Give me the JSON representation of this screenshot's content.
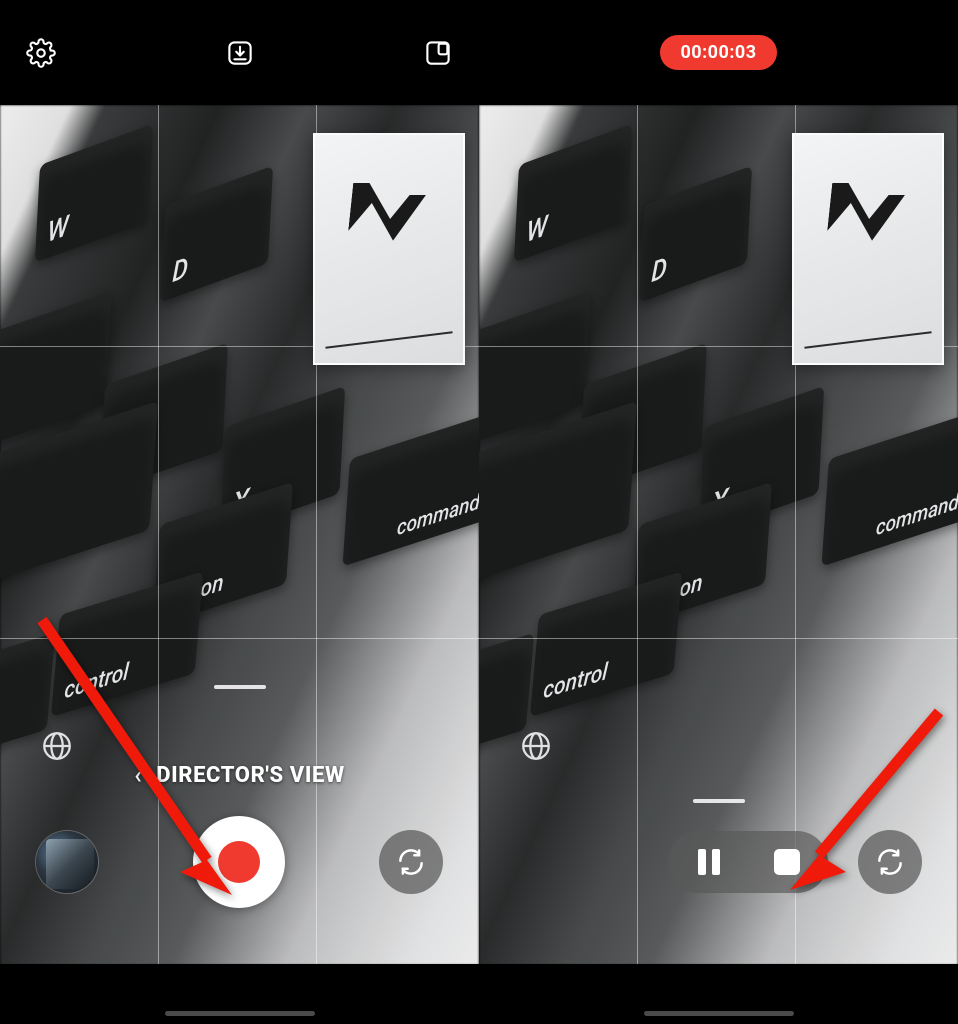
{
  "left": {
    "mode_label": "DIRECTOR'S VIEW",
    "icons": {
      "settings": "settings-icon",
      "download": "download-tray-icon",
      "layout": "layout-pip-icon",
      "switch": "camera-switch-icon",
      "globe": "globe-icon"
    }
  },
  "right": {
    "timer": "00:00:03",
    "icons": {
      "pause": "pause-icon",
      "stop": "stop-icon",
      "switch": "camera-switch-icon",
      "globe": "globe-icon"
    }
  },
  "colors": {
    "accent_red": "#f03a2f"
  }
}
